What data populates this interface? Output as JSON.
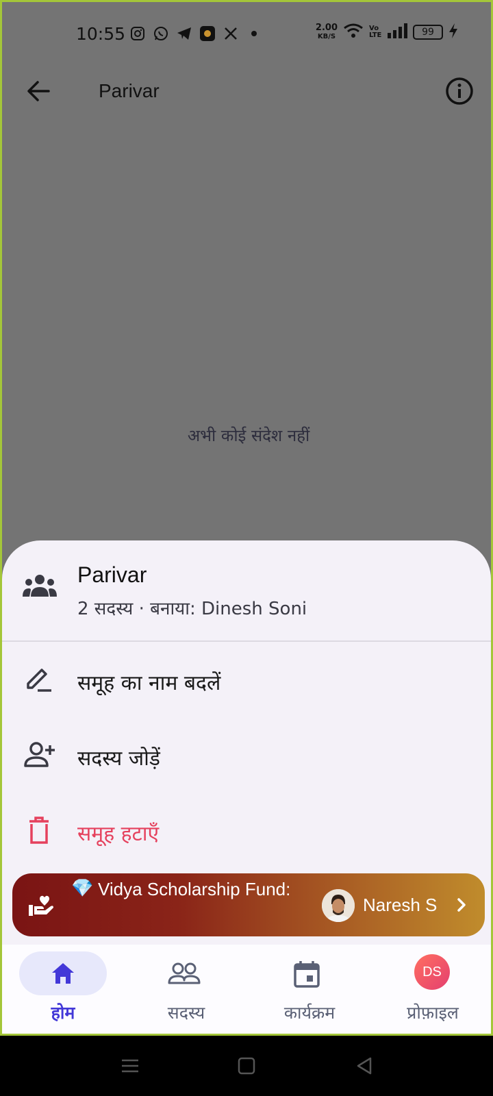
{
  "status_bar": {
    "time": "10:55",
    "net_speed_value": "2.00",
    "net_speed_unit": "KB/S",
    "volte": "Vo LTE",
    "battery": "99",
    "icons": [
      "instagram-icon",
      "whatsapp-icon",
      "telegram-icon",
      "app-icon",
      "x-icon",
      "dot-icon",
      "wifi-icon",
      "signal-icon",
      "battery-icon",
      "charging-icon"
    ]
  },
  "app_bar": {
    "title": "Parivar"
  },
  "chat": {
    "empty_message": "अभी कोई संदेश नहीं"
  },
  "sheet": {
    "title": "Parivar",
    "subtitle": "2 सदस्य · बनाया: Dinesh Soni",
    "items": [
      {
        "label": "समूह का नाम बदलें",
        "icon": "edit-icon"
      },
      {
        "label": "सदस्य जोड़ें",
        "icon": "add-person-icon"
      },
      {
        "label": "समूह हटाएँ",
        "icon": "trash-icon",
        "color": "#e5415d"
      }
    ]
  },
  "banner": {
    "emoji": "💎",
    "text": "Vidya Scholarship Fund:",
    "name": "Naresh S"
  },
  "bottom_nav": {
    "items": [
      {
        "label": "होम",
        "icon": "home-icon",
        "active": true
      },
      {
        "label": "सदस्य",
        "icon": "people-icon",
        "active": false
      },
      {
        "label": "कार्यक्रम",
        "icon": "calendar-icon",
        "active": false
      },
      {
        "label": "प्रोफ़ाइल",
        "icon": "profile-avatar",
        "active": false
      }
    ],
    "avatar_initials": "DS"
  },
  "colors": {
    "accent": "#4338d8",
    "danger": "#e5415d",
    "sheet_bg": "#f4f1f8",
    "scrim": "#747474"
  }
}
